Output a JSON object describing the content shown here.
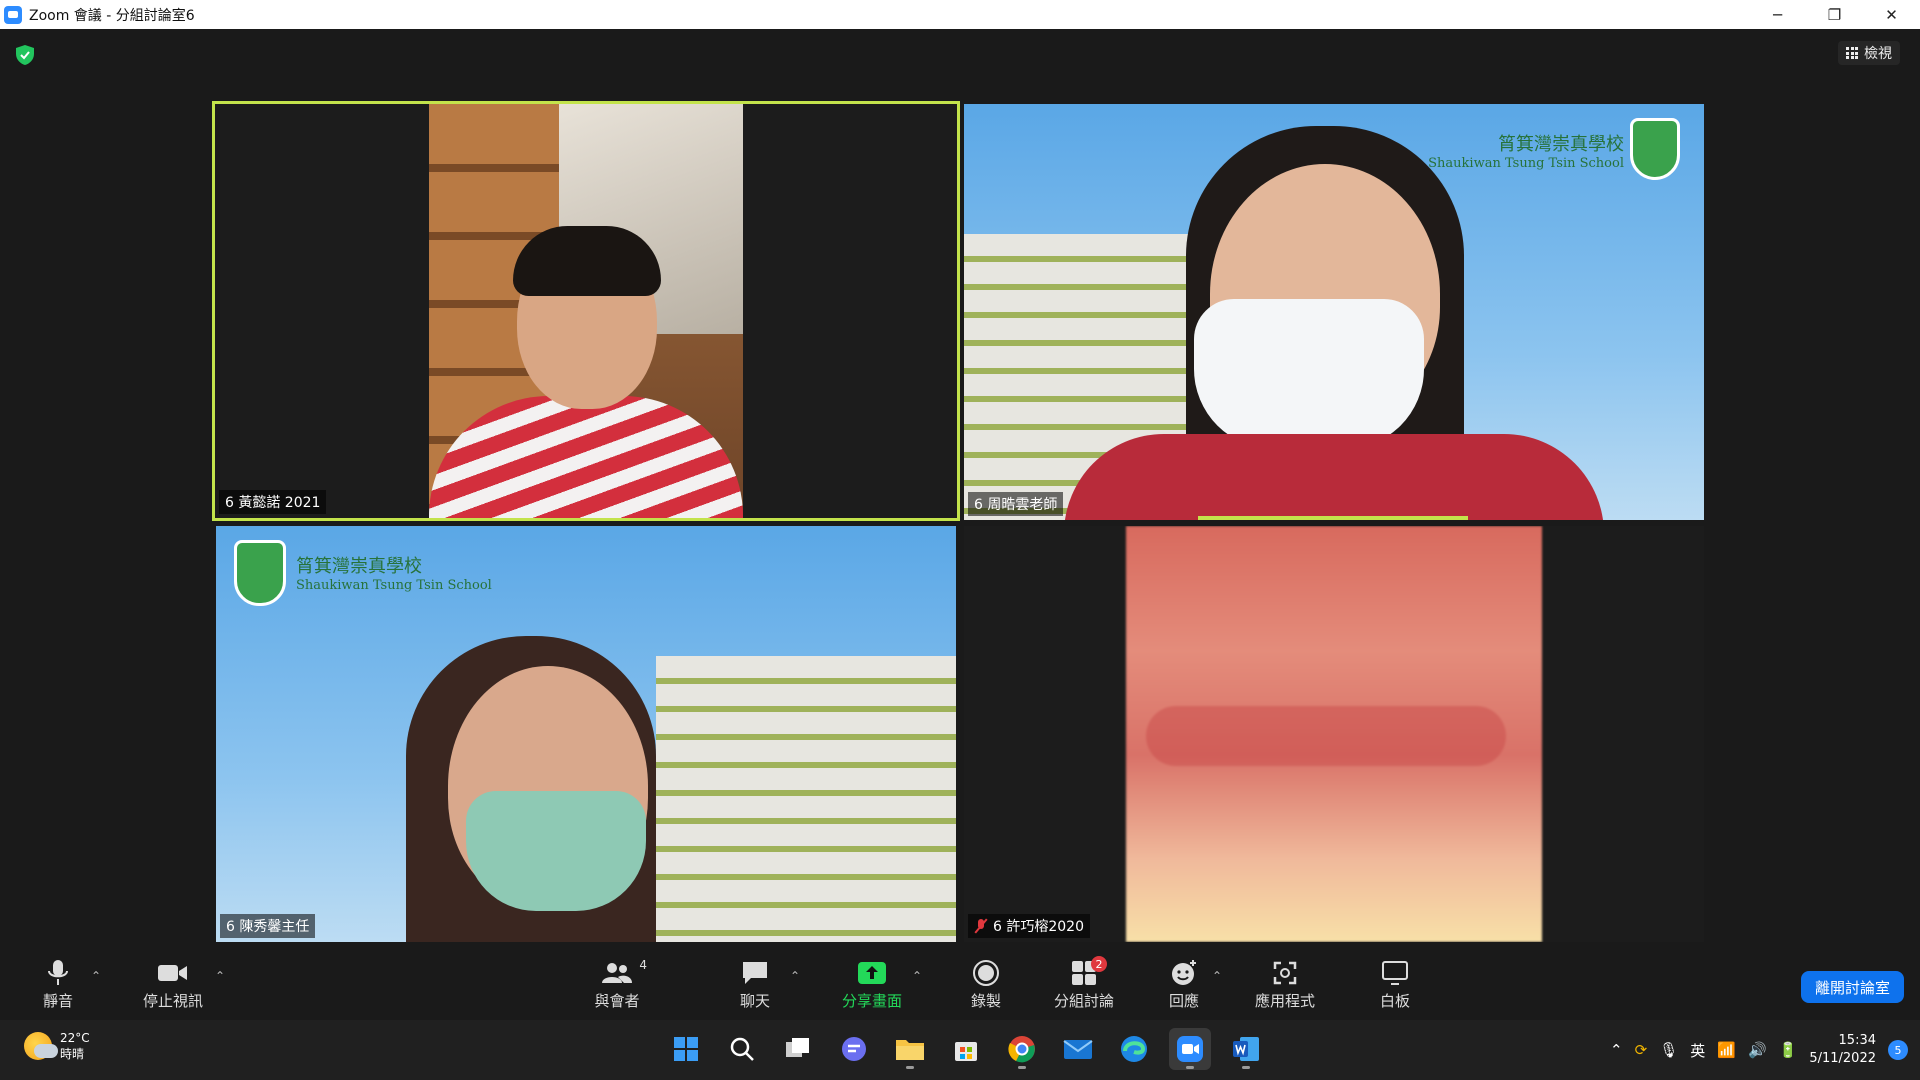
{
  "window": {
    "title": "Zoom 會議 - 分組討論室6",
    "minimize": "─",
    "restore": "❐",
    "close": "✕"
  },
  "header": {
    "view_label": "檢視"
  },
  "participants": [
    {
      "name": "6 黃懿諾 2021",
      "muted": false,
      "active": true
    },
    {
      "name": "6 周晧雲老師",
      "muted": false,
      "active": false
    },
    {
      "name": "6 陳秀馨主任",
      "muted": false,
      "active": false
    },
    {
      "name": "6 許巧榕2020",
      "muted": true,
      "active": false
    }
  ],
  "background": {
    "school_name_zh": "筲箕灣崇真學校",
    "school_name_en": "Shaukiwan Tsung Tsin School"
  },
  "toolbar": {
    "mute": "靜音",
    "stop_video": "停止視訊",
    "participants": "與會者",
    "participants_count": "4",
    "chat": "聊天",
    "share_screen": "分享畫面",
    "record": "錄製",
    "breakout_rooms": "分組討論",
    "breakout_badge": "2",
    "reactions": "回應",
    "apps": "應用程式",
    "whiteboard": "白板",
    "leave_room": "離開討論室"
  },
  "taskbar": {
    "temperature": "22°C",
    "weather": "時晴",
    "ime": "英",
    "time": "15:34",
    "date": "5/11/2022",
    "notification_count": "5"
  },
  "colors": {
    "active_speaker": "#c3e34b",
    "share_green": "#23d959",
    "leave_blue": "#0e72ed",
    "badge_red": "#e0383e"
  }
}
